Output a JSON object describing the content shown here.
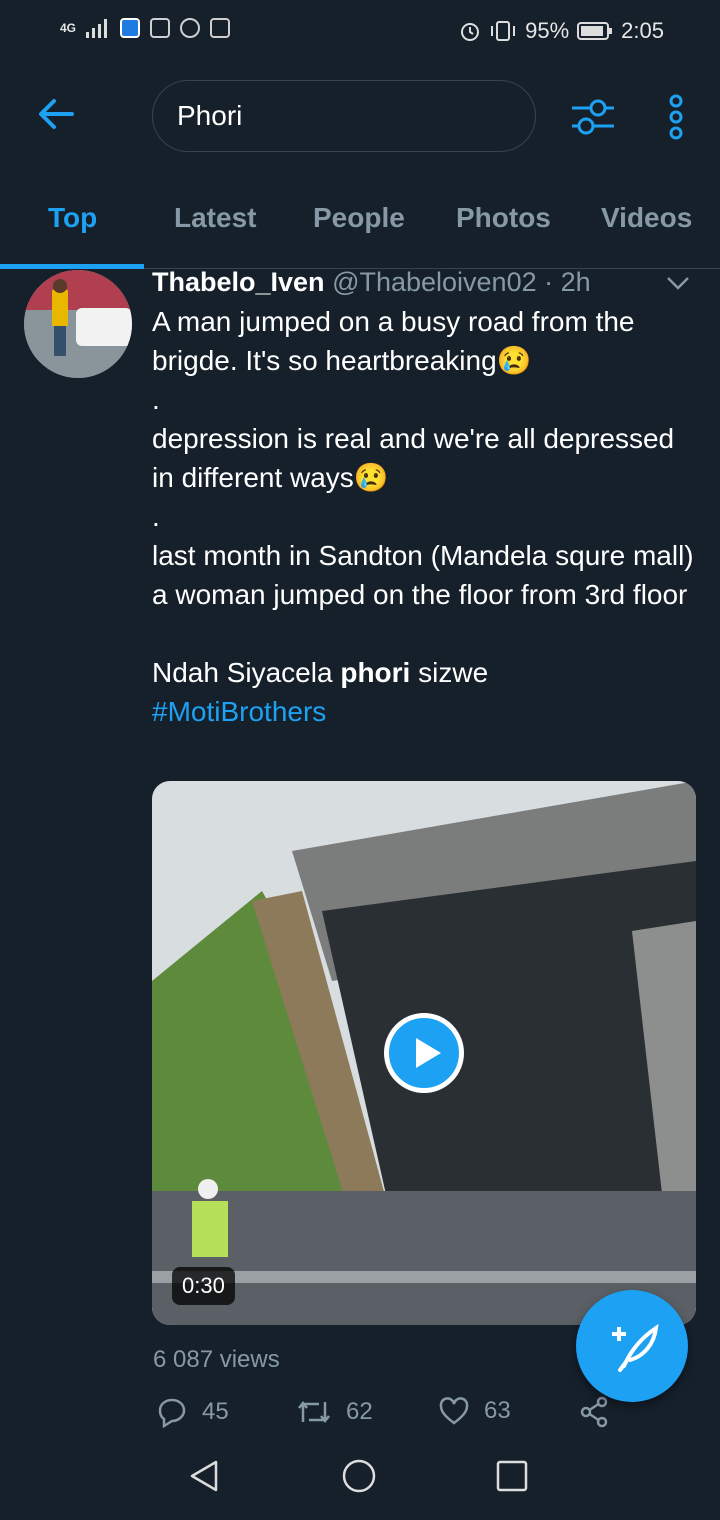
{
  "status_bar": {
    "network": "4G",
    "battery": "95%",
    "time": "2:05"
  },
  "search": {
    "query": "Phori"
  },
  "tabs": [
    "Top",
    "Latest",
    "People",
    "Photos",
    "Videos"
  ],
  "tweet": {
    "name": "Thabelo_Iven",
    "handle": "@Thabeloiven02",
    "time": "· 2h",
    "lines": [
      "A man jumped on a busy road from the brigde. It's so heartbreaking😢",
      ".",
      "depression is real and we're all depressed in different ways😢",
      ".",
      "last month in Sandton (Mandela squre mall) a woman jumped on the floor from 3rd floor"
    ],
    "last_line_before": "Ndah Siyacela ",
    "last_line_bold": "phori",
    "last_line_after": " sizwe",
    "hashtag": "#MotiBrothers",
    "video_duration": "0:30",
    "views": "6 087 views",
    "replies": "45",
    "retweets": "62",
    "likes": "63"
  },
  "colors": {
    "background": "#15202b",
    "accent": "#1da1f2",
    "muted": "#8899a6"
  }
}
